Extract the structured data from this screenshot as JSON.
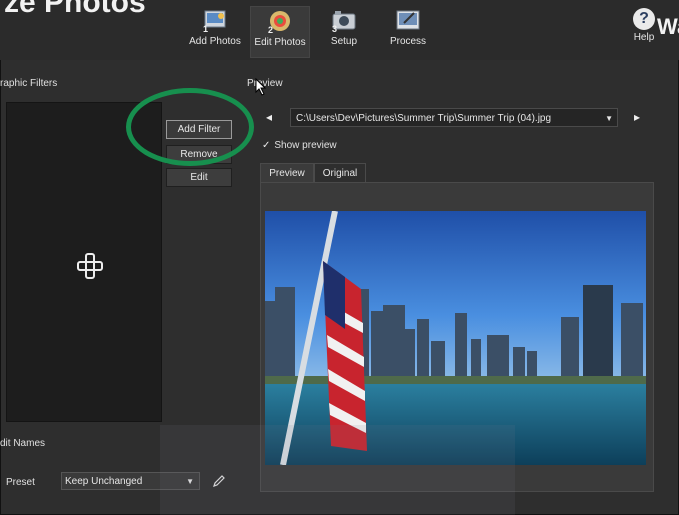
{
  "app": {
    "title_fragment": "ze Photos",
    "brand_fragment": "Wa"
  },
  "toolbar": {
    "items": [
      {
        "step": "1",
        "label": "Add Photos",
        "icon": "add-photos-icon"
      },
      {
        "step": "2",
        "label": "Edit Photos",
        "icon": "edit-photos-icon",
        "active": true
      },
      {
        "step": "3",
        "label": "Setup",
        "icon": "camera-setup-icon"
      },
      {
        "step": "",
        "label": "Process",
        "icon": "process-icon"
      }
    ],
    "help": {
      "glyph": "?",
      "label": "Help"
    }
  },
  "filters": {
    "section_label": "raphic Filters",
    "add_button": "Add Filter",
    "remove_button": "Remove",
    "edit_button": "Edit",
    "empty_icon": "plus-icon"
  },
  "preview": {
    "section_label": "Preview",
    "prev_arrow": "◂",
    "next_arrow": "▸",
    "path": "C:\\Users\\Dev\\Pictures\\Summer Trip\\Summer Trip (04).jpg",
    "show_preview_label": "Show preview",
    "show_preview_checked": true,
    "tabs": [
      {
        "label": "Preview",
        "selected": true
      },
      {
        "label": "Original",
        "selected": false
      }
    ]
  },
  "edit_names": {
    "section_label": "dit Names",
    "preset_label": "Preset",
    "preset_value": "Keep Unchanged",
    "pencil_icon": "pencil-icon"
  },
  "colors": {
    "background": "#2e2e2e",
    "highlight_ring": "#178f4e",
    "sky": "#2f6fc8",
    "water": "#1e6d8f"
  }
}
